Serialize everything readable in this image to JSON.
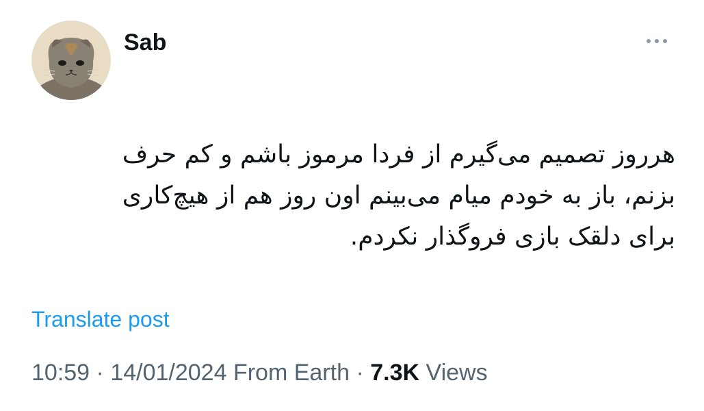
{
  "author": {
    "name": "Sab",
    "avatar_icon": "cat-avatar"
  },
  "more_icon": "ellipsis-icon",
  "post": {
    "lines": [
      "هرروز تصمیم می‌گیرم از فردا مرموز باشم و کم حرف",
      "بزنم، باز به خودم میام می‌بینم اون روز هم از هیچ‌کاری",
      "برای دلقک بازی فروگذار نکردم."
    ]
  },
  "translate_label": "Translate post",
  "meta": {
    "time": "10:59",
    "separator": "·",
    "date": "14/01/2024",
    "source": "From Earth",
    "views_count": "7.3K",
    "views_label": "Views"
  },
  "colors": {
    "text": "#0f1419",
    "secondary": "#536471",
    "link": "#1d9bf0"
  }
}
